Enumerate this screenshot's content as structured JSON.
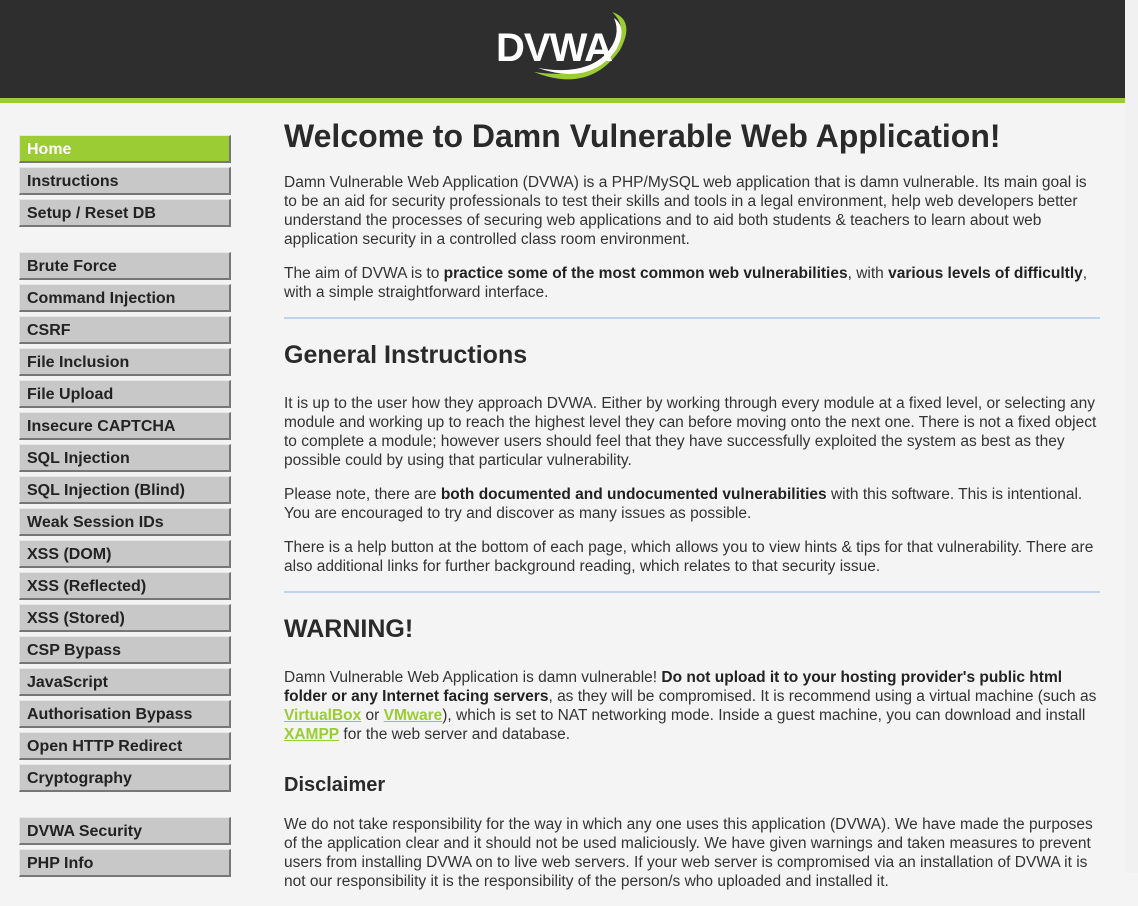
{
  "header": {
    "logo_text": "DVWA",
    "colors": {
      "header_bg": "#2e2e2e",
      "accent": "#9bcc33"
    }
  },
  "sidebar": {
    "group1": [
      {
        "label": "Home",
        "selected": true
      },
      {
        "label": "Instructions"
      },
      {
        "label": "Setup / Reset DB"
      }
    ],
    "group2": [
      {
        "label": "Brute Force"
      },
      {
        "label": "Command Injection"
      },
      {
        "label": "CSRF"
      },
      {
        "label": "File Inclusion"
      },
      {
        "label": "File Upload"
      },
      {
        "label": "Insecure CAPTCHA"
      },
      {
        "label": "SQL Injection"
      },
      {
        "label": "SQL Injection (Blind)"
      },
      {
        "label": "Weak Session IDs"
      },
      {
        "label": "XSS (DOM)"
      },
      {
        "label": "XSS (Reflected)"
      },
      {
        "label": "XSS (Stored)"
      },
      {
        "label": "CSP Bypass"
      },
      {
        "label": "JavaScript"
      },
      {
        "label": "Authorisation Bypass"
      },
      {
        "label": "Open HTTP Redirect"
      },
      {
        "label": "Cryptography"
      }
    ],
    "group3": [
      {
        "label": "DVWA Security"
      },
      {
        "label": "PHP Info"
      }
    ]
  },
  "main": {
    "title": "Welcome to Damn Vulnerable Web Application!",
    "intro": "Damn Vulnerable Web Application (DVWA) is a PHP/MySQL web application that is damn vulnerable. Its main goal is to be an aid for security professionals to test their skills and tools in a legal environment, help web developers better understand the processes of securing web applications and to aid both students & teachers to learn about web application security in a controlled class room environment.",
    "aim": {
      "t1": "The aim of DVWA is to ",
      "b1": "practice some of the most common web vulnerabilities",
      "t2": ", with ",
      "b2": "various levels of difficultly",
      "t3": ", with a simple straightforward interface."
    },
    "general": {
      "heading": "General Instructions",
      "p1": "It is up to the user how they approach DVWA. Either by working through every module at a fixed level, or selecting any module and working up to reach the highest level they can before moving onto the next one. There is not a fixed object to complete a module; however users should feel that they have successfully exploited the system as best as they possible could by using that particular vulnerability.",
      "p2": {
        "t1": "Please note, there are ",
        "b1": "both documented and undocumented vulnerabilities",
        "t2": " with this software. This is intentional. You are encouraged to try and discover as many issues as possible."
      },
      "p3": "There is a help button at the bottom of each page, which allows you to view hints & tips for that vulnerability. There are also additional links for further background reading, which relates to that security issue."
    },
    "warning": {
      "heading": "WARNING!",
      "t1": "Damn Vulnerable Web Application is damn vulnerable! ",
      "b1": "Do not upload it to your hosting provider's public html folder or any Internet facing servers",
      "t2": ", as they will be compromised. It is recommend using a virtual machine (such as ",
      "link1": "VirtualBox",
      "t3": " or ",
      "link2": "VMware",
      "t4": "), which is set to NAT networking mode. Inside a guest machine, you can download and install ",
      "link3": "XAMPP",
      "t5": " for the web server and database."
    },
    "disclaimer": {
      "heading": "Disclaimer",
      "p1": "We do not take responsibility for the way in which any one uses this application (DVWA). We have made the purposes of the application clear and it should not be used maliciously. We have given warnings and taken measures to prevent users from installing DVWA on to live web servers. If your web server is compromised via an installation of DVWA it is not our responsibility it is the responsibility of the person/s who uploaded and installed it."
    }
  }
}
